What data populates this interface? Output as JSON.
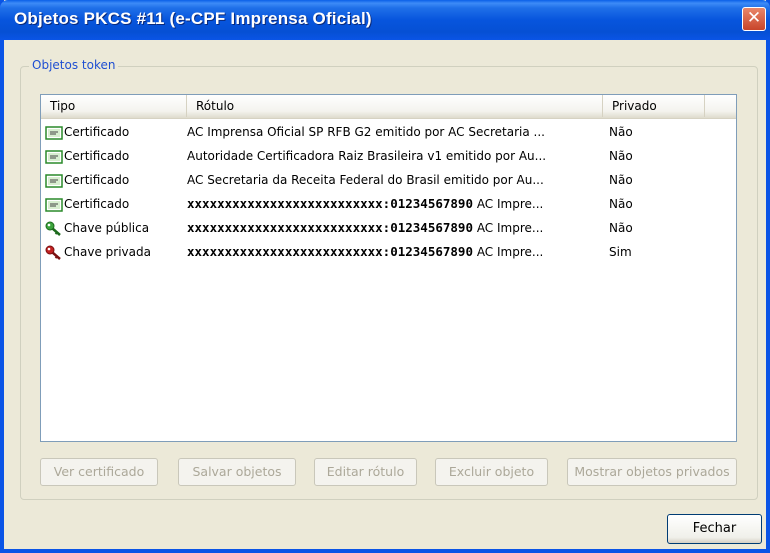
{
  "window": {
    "title": "Objetos PKCS #11 (e-CPF Imprensa Oficial)",
    "close_symbol": "✕"
  },
  "group": {
    "label": "Objetos token"
  },
  "columns": {
    "tipo": "Tipo",
    "rotulo": "Rótulo",
    "privado": "Privado"
  },
  "rows": [
    {
      "icon": "certificate-icon",
      "tipo": "Certificado",
      "rotulo": "AC Imprensa Oficial SP RFB G2 emitido por AC Secretaria ...",
      "privado": "Não"
    },
    {
      "icon": "certificate-icon",
      "tipo": "Certificado",
      "rotulo": "Autoridade Certificadora Raiz Brasileira v1 emitido por Au...",
      "privado": "Não"
    },
    {
      "icon": "certificate-icon",
      "tipo": "Certificado",
      "rotulo": "AC Secretaria da Receita Federal do Brasil emitido por Au...",
      "privado": "Não"
    },
    {
      "icon": "certificate-icon",
      "tipo": "Certificado",
      "rotulo_id": "xxxxxxxxxxxxxxxxxxxxxxxxxx:01234567890",
      "rotulo_suffix": "AC Impre...",
      "privado": "Não"
    },
    {
      "icon": "public-key-icon",
      "tipo": "Chave pública",
      "rotulo_id": "xxxxxxxxxxxxxxxxxxxxxxxxxx:01234567890",
      "rotulo_suffix": "AC Impre...",
      "privado": "Não"
    },
    {
      "icon": "private-key-icon",
      "tipo": "Chave privada",
      "rotulo_id": "xxxxxxxxxxxxxxxxxxxxxxxxxx:01234567890",
      "rotulo_suffix": "AC Impre...",
      "privado": "Sim"
    }
  ],
  "buttons": {
    "ver_certificado": "Ver certificado",
    "salvar_objetos": "Salvar objetos",
    "editar_rotulo": "Editar rótulo",
    "excluir_objeto": "Excluir objeto",
    "mostrar_privados": "Mostrar objetos privados",
    "fechar": "Fechar"
  },
  "colors": {
    "title_bar": "#0a54e6",
    "close_button": "#c8442a",
    "group_label": "#1f4fd2",
    "public_key": "#3ca43c",
    "private_key": "#c02020",
    "certificate": "#2a8a2a"
  }
}
